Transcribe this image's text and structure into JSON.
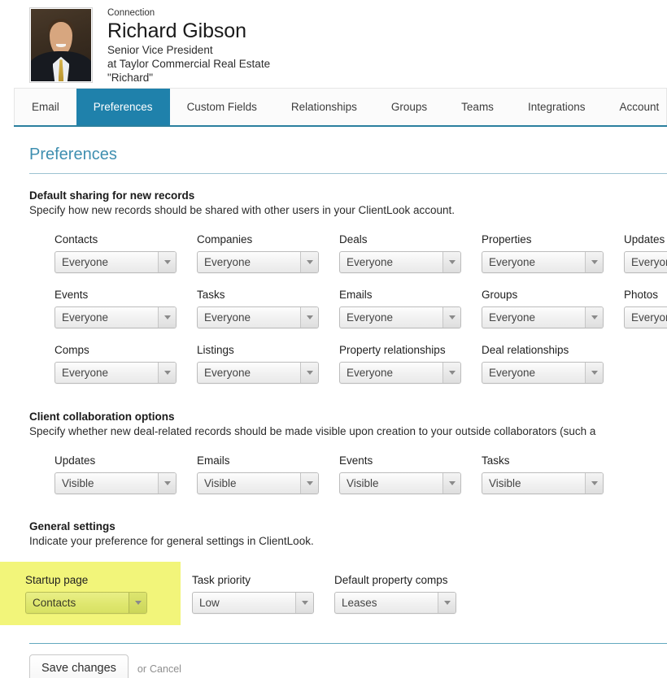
{
  "header": {
    "kicker": "Connection",
    "name": "Richard Gibson",
    "job_title": "Senior Vice President",
    "company_line": "at Taylor Commercial Real Estate",
    "nickname": "\"Richard\"",
    "avatar_alt": "profile-photo"
  },
  "tabs": [
    {
      "label": "Email",
      "active": false
    },
    {
      "label": "Preferences",
      "active": true
    },
    {
      "label": "Custom Fields",
      "active": false
    },
    {
      "label": "Relationships",
      "active": false
    },
    {
      "label": "Groups",
      "active": false
    },
    {
      "label": "Teams",
      "active": false
    },
    {
      "label": "Integrations",
      "active": false
    },
    {
      "label": "Account",
      "active": false
    }
  ],
  "page": {
    "title": "Preferences"
  },
  "sections": {
    "sharing": {
      "title": "Default sharing for new records",
      "description": "Specify how new records should be shared with other users in your ClientLook account.",
      "rows": [
        [
          {
            "label": "Contacts",
            "value": "Everyone"
          },
          {
            "label": "Companies",
            "value": "Everyone"
          },
          {
            "label": "Deals",
            "value": "Everyone"
          },
          {
            "label": "Properties",
            "value": "Everyone"
          },
          {
            "label": "Updates",
            "value": "Everyone"
          }
        ],
        [
          {
            "label": "Events",
            "value": "Everyone"
          },
          {
            "label": "Tasks",
            "value": "Everyone"
          },
          {
            "label": "Emails",
            "value": "Everyone"
          },
          {
            "label": "Groups",
            "value": "Everyone"
          },
          {
            "label": "Photos",
            "value": "Everyone"
          }
        ],
        [
          {
            "label": "Comps",
            "value": "Everyone"
          },
          {
            "label": "Listings",
            "value": "Everyone"
          },
          {
            "label": "Property relationships",
            "value": "Everyone"
          },
          {
            "label": "Deal relationships",
            "value": "Everyone"
          }
        ]
      ]
    },
    "collaboration": {
      "title": "Client collaboration options",
      "description": "Specify whether new deal-related records should be made visible upon creation to your outside collaborators (such a",
      "fields": [
        {
          "label": "Updates",
          "value": "Visible"
        },
        {
          "label": "Emails",
          "value": "Visible"
        },
        {
          "label": "Events",
          "value": "Visible"
        },
        {
          "label": "Tasks",
          "value": "Visible"
        }
      ]
    },
    "general": {
      "title": "General settings",
      "description": "Indicate your preference for general settings in ClientLook.",
      "highlighted": {
        "label": "Startup page",
        "value": "Contacts"
      },
      "fields": [
        {
          "label": "Task priority",
          "value": "Low"
        },
        {
          "label": "Default property comps",
          "value": "Leases"
        }
      ]
    }
  },
  "footer": {
    "save_label": "Save changes",
    "or_text": "or",
    "cancel_label": "Cancel"
  },
  "colors": {
    "active_tab": "#1f81ab",
    "title": "#3f8fb0",
    "rule": "#63a9bf",
    "highlight": "#f2f57a"
  }
}
